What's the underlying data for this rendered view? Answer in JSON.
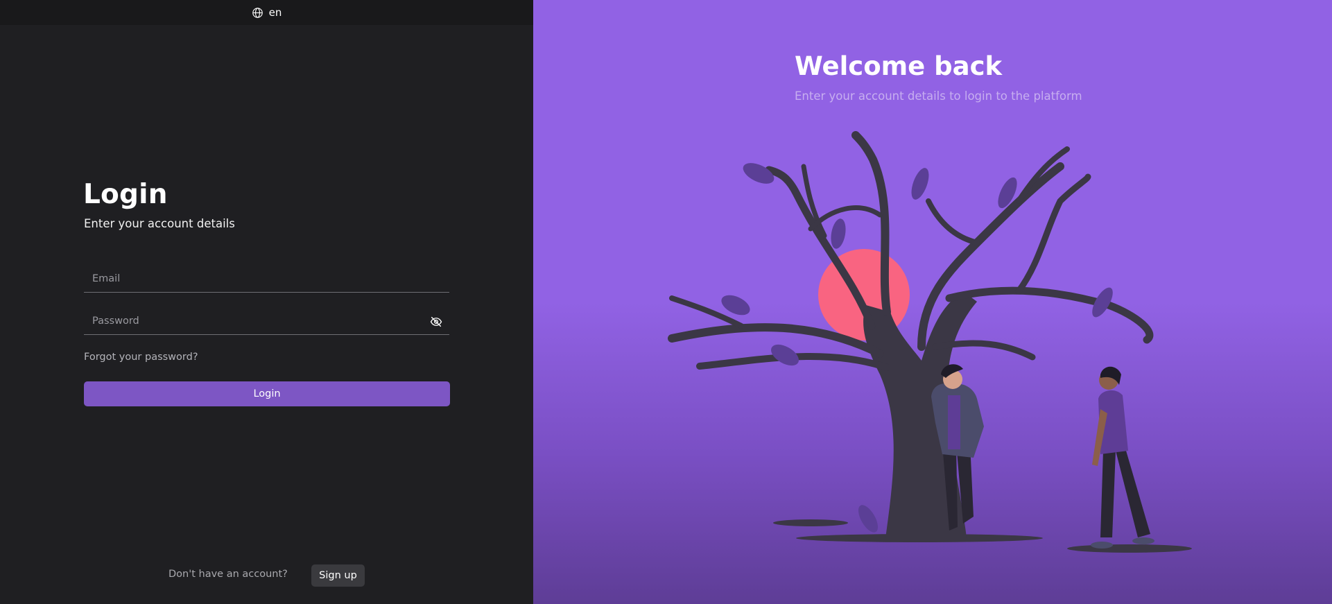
{
  "language": {
    "current": "en",
    "icon": "globe-icon"
  },
  "login": {
    "title": "Login",
    "subtitle": "Enter your account details",
    "email_placeholder": "Email",
    "password_placeholder": "Password",
    "password_toggle_icon": "eye-off-icon",
    "forgot_password": "Forgot your password?",
    "submit_label": "Login"
  },
  "signup": {
    "prompt": "Don't have an account?",
    "button_label": "Sign up"
  },
  "hero": {
    "title": "Welcome back",
    "subtitle": "Enter your account details to login to the platform",
    "illustration": "tree-with-two-people"
  },
  "colors": {
    "left_bg": "#1f1f22",
    "accent": "#7d56c4",
    "hero_bg": "#9162e4",
    "sun": "#f96481",
    "tree": "#3b3745"
  }
}
